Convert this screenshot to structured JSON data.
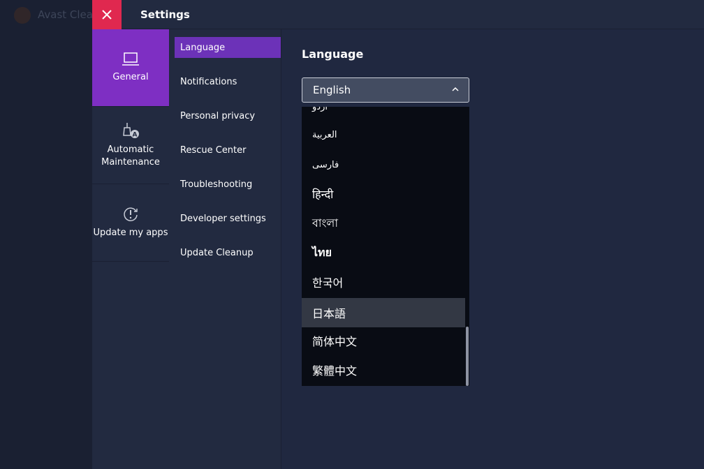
{
  "app": {
    "background_title": "Avast Cleanup",
    "window_title": "Settings"
  },
  "nav_primary": [
    {
      "label": "General",
      "icon": "laptop-icon",
      "active": true
    },
    {
      "label": "Automatic Maintenance",
      "icon": "broom-auto-icon",
      "active": false
    },
    {
      "label": "Update my apps",
      "icon": "update-alert-icon",
      "active": false
    }
  ],
  "nav_secondary": [
    {
      "label": "Language",
      "active": true
    },
    {
      "label": "Notifications",
      "active": false
    },
    {
      "label": "Personal privacy",
      "active": false
    },
    {
      "label": "Rescue Center",
      "active": false
    },
    {
      "label": "Troubleshooting",
      "active": false
    },
    {
      "label": "Developer settings",
      "active": false
    },
    {
      "label": "Update Cleanup",
      "active": false
    }
  ],
  "main": {
    "heading": "Language",
    "language_select": {
      "value": "English",
      "options": [
        {
          "label": "اردو",
          "highlighted": false
        },
        {
          "label": "العربية",
          "highlighted": false
        },
        {
          "label": "فارسی",
          "highlighted": false
        },
        {
          "label": "हिन्दी",
          "highlighted": false
        },
        {
          "label": "বাংলা",
          "highlighted": false
        },
        {
          "label": "ไทย",
          "highlighted": false
        },
        {
          "label": "한국어",
          "highlighted": false
        },
        {
          "label": "日本語",
          "highlighted": true
        },
        {
          "label": "简体中文",
          "highlighted": false
        },
        {
          "label": "繁體中文",
          "highlighted": false
        }
      ]
    }
  },
  "colors": {
    "accent": "#7e2fc3",
    "close": "#e0284f",
    "panel": "#222a40",
    "dropdown": "#090c14"
  }
}
